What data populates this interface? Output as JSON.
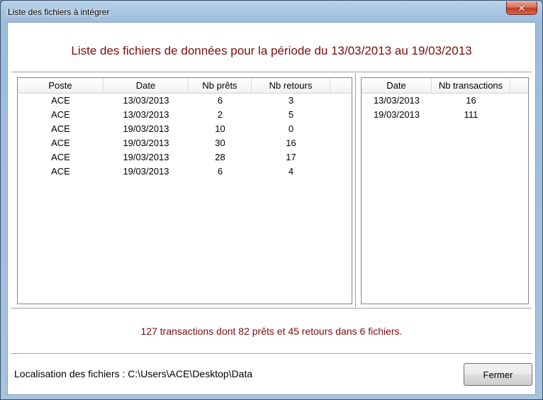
{
  "window": {
    "title": "Liste des fichiers à intégrer",
    "close_glyph": "✕"
  },
  "heading": "Liste des fichiers de données pour la période du 13/03/2013 au 19/03/2013",
  "left_table": {
    "columns": [
      "Poste",
      "Date",
      "Nb prêts",
      "Nb retours"
    ],
    "rows": [
      [
        "ACE",
        "13/03/2013",
        "6",
        "3"
      ],
      [
        "ACE",
        "13/03/2013",
        "2",
        "5"
      ],
      [
        "ACE",
        "19/03/2013",
        "10",
        "0"
      ],
      [
        "ACE",
        "19/03/2013",
        "30",
        "16"
      ],
      [
        "ACE",
        "19/03/2013",
        "28",
        "17"
      ],
      [
        "ACE",
        "19/03/2013",
        "6",
        "4"
      ]
    ]
  },
  "right_table": {
    "columns": [
      "Date",
      "Nb transactions"
    ],
    "rows": [
      [
        "13/03/2013",
        "16"
      ],
      [
        "19/03/2013",
        "111"
      ]
    ]
  },
  "summary": "127 transactions dont 82 prêts et 45 retours dans 6 fichiers.",
  "location": "Localisation des fichiers : C:\\Users\\ACE\\Desktop\\Data",
  "close_button_label": "Fermer",
  "colors": {
    "accent_text": "#7a0d0d",
    "close_button_red": "#c23d24"
  }
}
